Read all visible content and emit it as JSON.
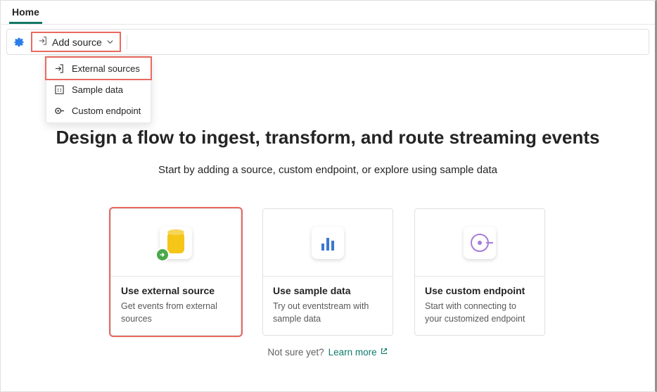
{
  "tabs": {
    "home": "Home"
  },
  "toolbar": {
    "add_source": "Add source"
  },
  "dropdown": {
    "external": "External sources",
    "sample": "Sample data",
    "custom": "Custom endpoint"
  },
  "hero": {
    "title": "Design a flow to ingest, transform, and route streaming events",
    "subtitle": "Start by adding a source, custom endpoint, or explore using sample data"
  },
  "cards": {
    "external": {
      "title": "Use external source",
      "desc": "Get events from external sources"
    },
    "sample": {
      "title": "Use sample data",
      "desc": "Try out eventstream with sample data"
    },
    "custom": {
      "title": "Use custom endpoint",
      "desc": "Start with connecting to your customized endpoint"
    }
  },
  "footer": {
    "not_sure": "Not sure yet?",
    "learn_more": "Learn more"
  },
  "highlights": {
    "add_source_button": true,
    "dropdown_external": true,
    "card_external": true
  }
}
